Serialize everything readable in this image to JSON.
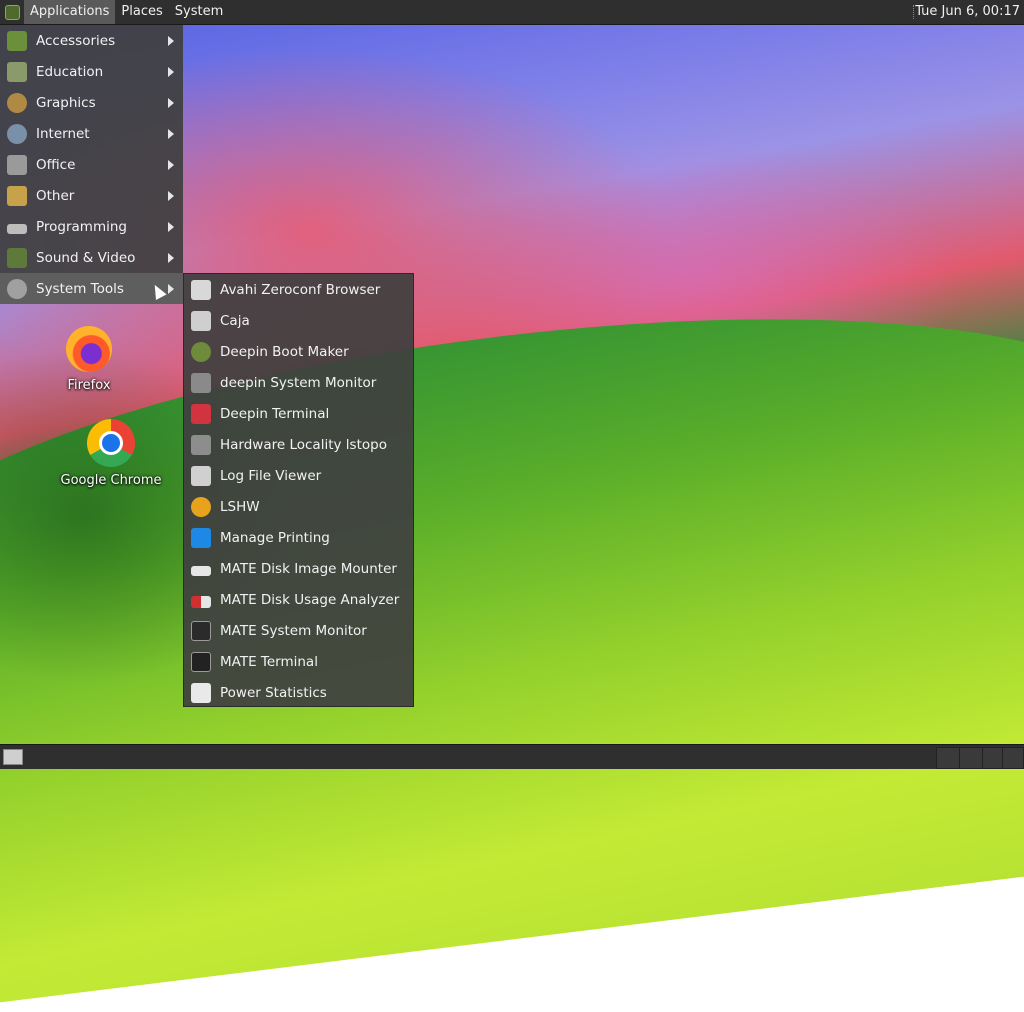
{
  "top_panel": {
    "menus": [
      "Applications",
      "Places",
      "System"
    ],
    "clock": "Tue Jun  6, 00:17"
  },
  "applications_menu": {
    "categories": [
      {
        "label": "Accessories",
        "icon": "accessories-icon"
      },
      {
        "label": "Education",
        "icon": "education-icon"
      },
      {
        "label": "Graphics",
        "icon": "graphics-icon"
      },
      {
        "label": "Internet",
        "icon": "internet-icon"
      },
      {
        "label": "Office",
        "icon": "office-icon"
      },
      {
        "label": "Other",
        "icon": "other-icon"
      },
      {
        "label": "Programming",
        "icon": "programming-icon"
      },
      {
        "label": "Sound & Video",
        "icon": "sound-video-icon"
      },
      {
        "label": "System Tools",
        "icon": "system-tools-icon"
      }
    ],
    "active_category": "System Tools"
  },
  "system_tools_submenu": {
    "items": [
      {
        "label": "Avahi Zeroconf Browser",
        "icon": "avahi-icon"
      },
      {
        "label": "Caja",
        "icon": "caja-icon"
      },
      {
        "label": "Deepin Boot Maker",
        "icon": "deepin-boot-maker-icon"
      },
      {
        "label": "deepin System Monitor",
        "icon": "deepin-system-monitor-icon"
      },
      {
        "label": "Deepin Terminal",
        "icon": "deepin-terminal-icon"
      },
      {
        "label": "Hardware Locality lstopo",
        "icon": "lstopo-icon"
      },
      {
        "label": "Log File Viewer",
        "icon": "log-viewer-icon"
      },
      {
        "label": "LSHW",
        "icon": "lshw-icon"
      },
      {
        "label": "Manage Printing",
        "icon": "printing-icon"
      },
      {
        "label": "MATE Disk Image Mounter",
        "icon": "disk-mounter-icon"
      },
      {
        "label": "MATE Disk Usage Analyzer",
        "icon": "disk-usage-icon"
      },
      {
        "label": "MATE System Monitor",
        "icon": "system-monitor-icon"
      },
      {
        "label": "MATE Terminal",
        "icon": "terminal-icon"
      },
      {
        "label": "Power Statistics",
        "icon": "power-stats-icon"
      }
    ]
  },
  "desktop_icons": [
    {
      "label": "Firefox",
      "icon": "firefox-icon"
    },
    {
      "label": "Google Chrome",
      "icon": "chrome-icon"
    }
  ]
}
